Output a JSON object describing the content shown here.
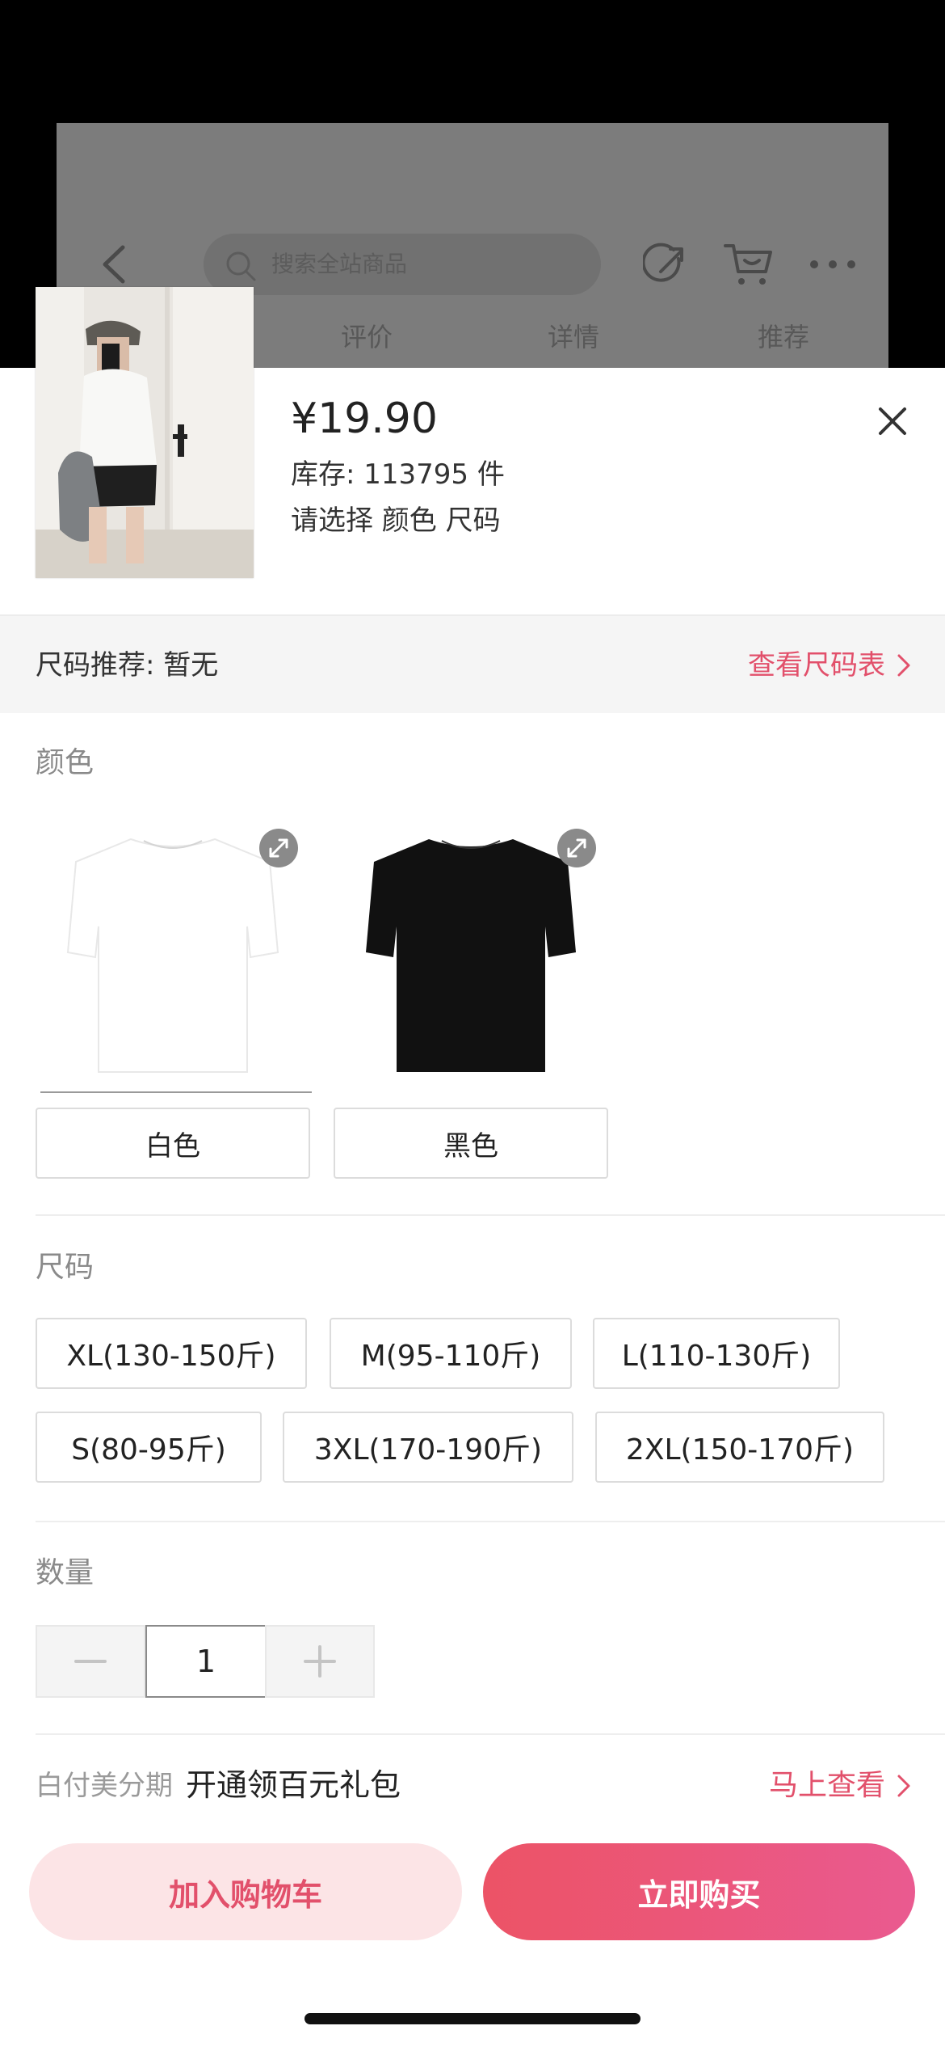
{
  "background_page": {
    "search_placeholder": "搜索全站商品",
    "tabs": [
      "评价",
      "详情",
      "推荐"
    ]
  },
  "product": {
    "price": "¥19.90",
    "stock": "库存: 113795 件",
    "select_hint": "请选择 颜色 尺码"
  },
  "size_recommendation": {
    "text": "尺码推荐: 暂无",
    "link": "查看尺码表"
  },
  "color_section": {
    "title": "颜色",
    "options": [
      {
        "label": "白色",
        "color": "#ffffff",
        "selected": true
      },
      {
        "label": "黑色",
        "color": "#111111",
        "selected": false
      }
    ]
  },
  "size_section": {
    "title": "尺码",
    "options": [
      "XL(130-150斤)",
      "M(95-110斤)",
      "L(110-130斤)",
      "S(80-95斤)",
      "3XL(170-190斤)",
      "2XL(150-170斤)"
    ]
  },
  "quantity": {
    "title": "数量",
    "value": "1"
  },
  "installment": {
    "label": "白付美分期",
    "promo": "开通领百元礼包",
    "link": "马上查看"
  },
  "actions": {
    "add_to_cart": "加入购物车",
    "buy_now": "立即购买"
  },
  "colors": {
    "accent": "#e2506b",
    "accent_light": "#fce4e6"
  }
}
